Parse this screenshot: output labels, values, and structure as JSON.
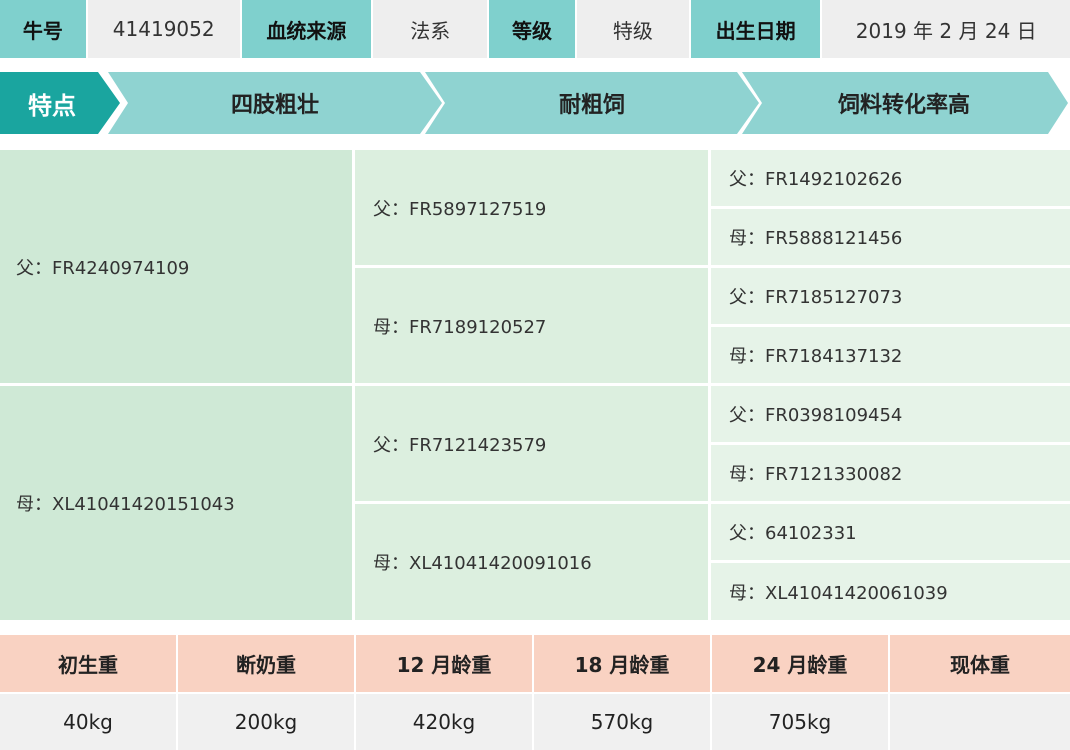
{
  "info": {
    "id_label": "牛号",
    "id_value": "41419052",
    "origin_label": "血统来源",
    "origin_value": "法系",
    "grade_label": "等级",
    "grade_value": "特级",
    "birth_label": "出生日期",
    "birth_value": "2019 年 2 月 24 日"
  },
  "features": {
    "label": "特点",
    "items": [
      "四肢粗壮",
      "耐粗饲",
      "饲料转化率高"
    ]
  },
  "pedigree": {
    "sire": "父：FR4240974109",
    "dam": "母：XL41041420151043",
    "sire_sire": "父：FR5897127519",
    "sire_dam": "母：FR7189120527",
    "dam_sire": "父：FR7121423579",
    "dam_dam": "母：XL41041420091016",
    "gg": [
      "父：FR1492102626",
      "母：FR5888121456",
      "父：FR7185127073",
      "母：FR7184137132",
      "父：FR0398109454",
      "母：FR7121330082",
      "父：64102331",
      "母：XL41041420061039"
    ]
  },
  "weights": {
    "headers": [
      "初生重",
      "断奶重",
      "12 月龄重",
      "18 月龄重",
      "24 月龄重",
      "现体重"
    ],
    "values": [
      "40kg",
      "200kg",
      "420kg",
      "570kg",
      "705kg",
      ""
    ]
  },
  "colors": {
    "teal_dark": "#1aa59f",
    "teal_light": "#8fd3d1",
    "label_bg": "#7fd0cd",
    "value_bg": "#eeeeee",
    "salmon": "#f9d2c2"
  }
}
